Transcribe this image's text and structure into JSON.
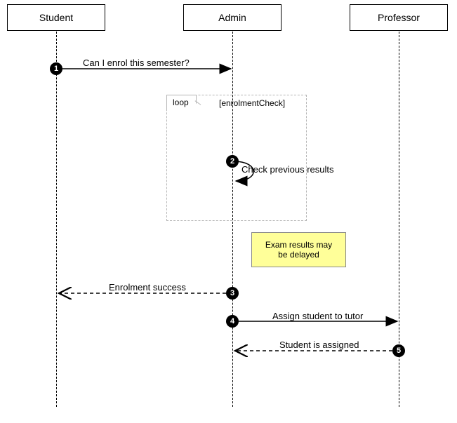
{
  "participants": {
    "student": "Student",
    "admin": "Admin",
    "professor": "Professor"
  },
  "messages": {
    "m1": {
      "num": "1",
      "text": "Can I enrol this semester?"
    },
    "m2": {
      "num": "2",
      "text": "Check previous results"
    },
    "m3": {
      "num": "3",
      "text": "Enrolment success"
    },
    "m4": {
      "num": "4",
      "text": "Assign student to tutor"
    },
    "m5": {
      "num": "5",
      "text": "Student is assigned"
    }
  },
  "fragment": {
    "label": "loop",
    "guard": "[enrolmentCheck]"
  },
  "note": {
    "line1": "Exam results may",
    "line2": "be delayed"
  },
  "chart_data": {
    "type": "table",
    "diagram": "UML sequence diagram",
    "participants": [
      "Student",
      "Admin",
      "Professor"
    ],
    "interactions": [
      {
        "seq": 1,
        "from": "Student",
        "to": "Admin",
        "message": "Can I enrol this semester?",
        "kind": "sync"
      },
      {
        "seq": 2,
        "from": "Admin",
        "to": "Admin",
        "message": "Check previous results",
        "kind": "self",
        "fragment": "loop",
        "guard": "enrolmentCheck"
      },
      {
        "seq": 3,
        "from": "Admin",
        "to": "Student",
        "message": "Enrolment success",
        "kind": "return"
      },
      {
        "seq": 4,
        "from": "Admin",
        "to": "Professor",
        "message": "Assign student to tutor",
        "kind": "sync"
      },
      {
        "seq": 5,
        "from": "Professor",
        "to": "Admin",
        "message": "Student is assigned",
        "kind": "return"
      }
    ],
    "note": {
      "attached_to": "Admin",
      "text": "Exam results may be delayed"
    }
  }
}
